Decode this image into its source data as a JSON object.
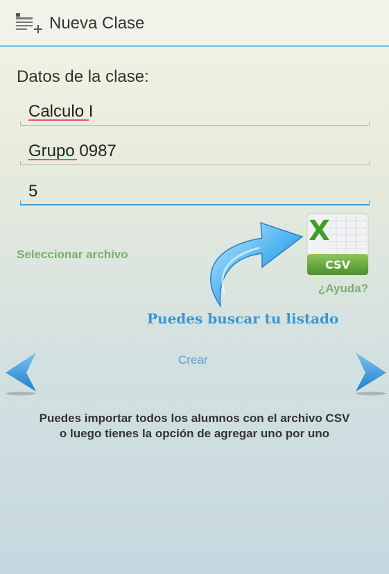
{
  "header": {
    "icon": "new-list-icon",
    "title": "Nueva Clase"
  },
  "form": {
    "section_label": "Datos de la clase:",
    "fields": [
      {
        "name": "class-name",
        "value": "Calculo I"
      },
      {
        "name": "group",
        "value": "Grupo 0987"
      },
      {
        "name": "number",
        "value": "5"
      }
    ],
    "select_file_label": "Seleccionar archivo",
    "csv_icon": "excel-csv-icon",
    "csv_label": "CSV",
    "help_label": "¿Ayuda?",
    "hint_text": "Puedes buscar tu listado",
    "create_label": "Crear"
  },
  "nav": {
    "prev_icon": "chevron-left-icon",
    "next_icon": "chevron-right-icon"
  },
  "info": {
    "line1": "Puedes importar todos los alumnos con el archivo CSV",
    "line2": "o luego tienes la opción de agregar uno por uno"
  },
  "colors": {
    "accent": "#3aa3dc",
    "green_link": "#7cad6f",
    "hint_blue": "#3a96d2",
    "spell_underline": "#e2546a"
  }
}
